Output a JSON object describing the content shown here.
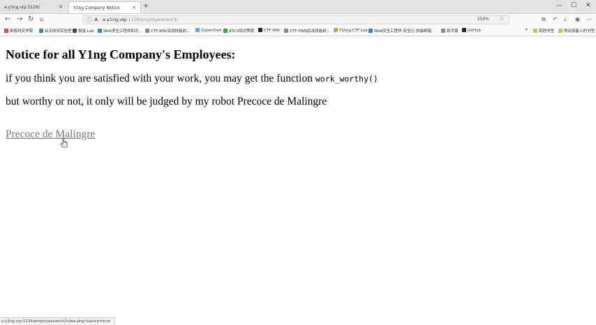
{
  "browser": {
    "tabs": [
      {
        "label": "a.y1ng.vip:3126/",
        "active": false
      },
      {
        "label": "Y1ng Company Notice",
        "active": true
      }
    ],
    "url": {
      "host": "a.y1ng.vip",
      "path": ":1126/employeeswork/"
    },
    "zoom": "250%",
    "bookmarks": [
      {
        "label": "极客网安学院",
        "color": "#d84a3a"
      },
      {
        "label": "合天网安实验室",
        "color": "#3a7bd8"
      },
      {
        "label": "极鼠 Lab",
        "color": "#444444"
      },
      {
        "label": "Web安全工程师知识...",
        "color": "#3a7bd8"
      },
      {
        "label": "CTF-Wiki实战技能树...",
        "color": "#888888"
      },
      {
        "label": "CyberChef",
        "color": "#6a9fd8"
      },
      {
        "label": "ASCII码对照表",
        "color": "#3aa24a"
      },
      {
        "label": "CTF Wiki",
        "color": "#222222"
      },
      {
        "label": "CTF-PWN实战技能树...",
        "color": "#888888"
      },
      {
        "label": "Y1ling-CTF Lab",
        "color": "#d89a3a"
      },
      {
        "label": "Web安全工程师-安全...",
        "color": "#3a7bd8"
      },
      {
        "label": "拼接邮箱",
        "color": "#cccccc"
      },
      {
        "label": "新手篇",
        "color": "#888888"
      },
      {
        "label": "GitHub",
        "color": "#222222"
      },
      {
        "label": "其他书签",
        "color": "#e0b84a"
      },
      {
        "label": "移动设备上的书签",
        "color": "#e0b84a"
      }
    ],
    "status_url": "a.y1ng.vip:1126/employeeswork/index.php?source=true"
  },
  "page": {
    "heading": "Notice for all Y1ng Company's Employees:",
    "line1_text": "if you think you are satisfied with your work, you may get the function ",
    "line1_code": "work_worthy()",
    "line2_text": "but worthy or not, it only will be judged by my robot Precoce de Malingre",
    "link_text": "Precoce de Malingre"
  },
  "colors": {
    "link": "#777777",
    "background": "#ffffff"
  }
}
